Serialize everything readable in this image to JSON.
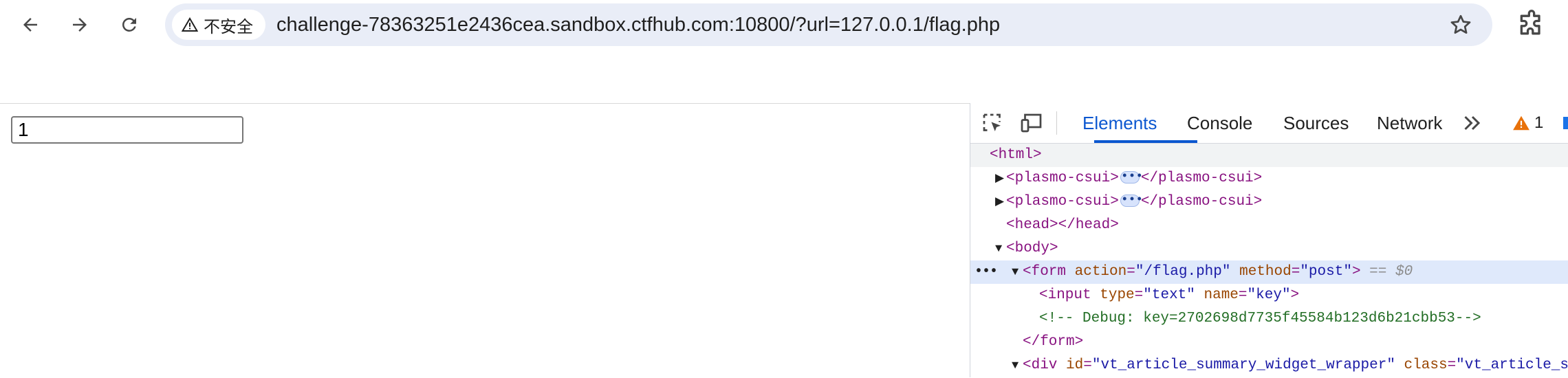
{
  "browser": {
    "security_label": "不安全",
    "url": "challenge-78363251e2436cea.sandbox.ctfhub.com:10800/?url=127.0.0.1/flag.php"
  },
  "page": {
    "key_input_value": "1"
  },
  "devtools": {
    "tabs": [
      "Elements",
      "Console",
      "Sources",
      "Network"
    ],
    "more_tabs_icon": "double-chevron-right",
    "warning_count": "1",
    "tree": {
      "html_open": "<html>",
      "plasmo_open": "<plasmo-csui>",
      "plasmo_close": "</plasmo-csui>",
      "head": "<head></head>",
      "body_open": "<body>",
      "form_tag_open": "<form",
      "form_action_attr": "action",
      "form_action_val": "\"/flag.php\"",
      "form_method_attr": "method",
      "form_method_val": "\"post\"",
      "form_tag_end": ">",
      "selected_marker": "== $0",
      "input_tag_open": "<input",
      "input_type_attr": "type",
      "input_type_val": "\"text\"",
      "input_name_attr": "name",
      "input_name_val": "\"key\"",
      "input_tag_end": ">",
      "comment": "<!-- Debug: key=2702698d7735f45584b123d6b21cbb53-->",
      "form_close": "</form>",
      "div_tag_open": "<div",
      "div_id_attr": "id",
      "div_id_val": "\"vt_article_summary_widget_wrapper\"",
      "div_class_attr": "class",
      "div_class_val": "\"vt_article_summ"
    }
  },
  "colors": {
    "accent": "#0b57d0",
    "selected_row": "#dfe9fb",
    "tag": "#881280",
    "attr_name": "#994500",
    "attr_value": "#1a1aa6",
    "comment": "#236e25",
    "warning": "#e8710a"
  }
}
